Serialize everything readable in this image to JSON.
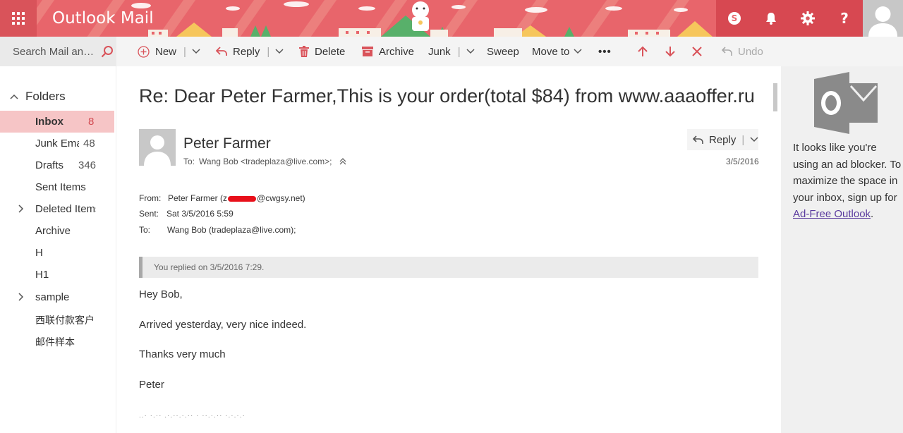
{
  "header": {
    "app_title": "Outlook Mail",
    "icons": [
      "waffle-icon",
      "skype-icon",
      "bell-icon",
      "gear-icon",
      "help-icon",
      "user-avatar-icon"
    ],
    "accent_color": "#e8656b"
  },
  "search": {
    "placeholder": "Search Mail and People"
  },
  "toolbar": {
    "new_label": "New",
    "reply_label": "Reply",
    "delete_label": "Delete",
    "archive_label": "Archive",
    "junk_label": "Junk",
    "sweep_label": "Sweep",
    "moveto_label": "Move to",
    "more_label": "•••",
    "undo_label": "Undo"
  },
  "nav": {
    "folders_label": "Folders",
    "items": [
      {
        "label": "Inbox",
        "count": "8"
      },
      {
        "label": "Junk Email",
        "count": "48"
      },
      {
        "label": "Drafts",
        "count": "346"
      },
      {
        "label": "Sent Items",
        "count": ""
      },
      {
        "label": "Deleted Items",
        "count": ""
      },
      {
        "label": "Archive",
        "count": ""
      },
      {
        "label": "H",
        "count": ""
      },
      {
        "label": "H1",
        "count": ""
      },
      {
        "label": "sample",
        "count": ""
      },
      {
        "label": "西联付款客户",
        "count": ""
      },
      {
        "label": "邮件样本",
        "count": ""
      }
    ]
  },
  "message": {
    "subject": "Re: Dear Peter Farmer,This is your order(total $84) from www.aaaoffer.ru",
    "sender_name": "Peter Farmer",
    "to_label": "To:",
    "to_value": "Wang Bob <tradeplaza@live.com>;",
    "reply_label": "Reply",
    "date": "3/5/2016",
    "from_label": "From:",
    "from_value_pre": "Peter Farmer (z",
    "from_value_post": "@cwgsy.net)",
    "sent_label": "Sent:",
    "sent_value": "Sat 3/5/2016 5:59",
    "to2_label": "To:",
    "to2_value": "Wang Bob (tradeplaza@live.com);",
    "replied_notice": "You replied on 3/5/2016 7:29.",
    "body": [
      "Hey Bob,",
      "Arrived yesterday, very nice indeed.",
      "Thanks very much",
      "Peter"
    ],
    "faded_line": "..· ·.·· .·.··.·.·· · ··.·.·· ·.·.·.·"
  },
  "ad": {
    "text": "It looks like you're using an ad blocker. To maximize the space in your inbox, sign up for",
    "link_text": "Ad-Free Outlook",
    "trailing": "."
  }
}
